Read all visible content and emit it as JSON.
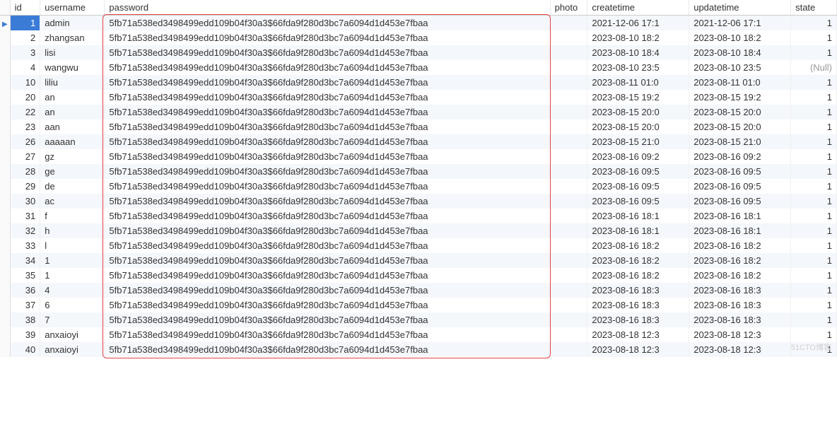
{
  "headers": {
    "id": "id",
    "username": "username",
    "password": "password",
    "photo": "photo",
    "createtime": "createtime",
    "updatetime": "updatetime",
    "state": "state"
  },
  "null_text": "(Null)",
  "watermark": "51CTO博客",
  "password_hash": "5fb71a538ed3498499edd109b04f30a3$66fda9f280d3bc7a6094d1d453e7fbaa",
  "rows": [
    {
      "id": "1",
      "username": "admin",
      "createtime": "2021-12-06 17:1",
      "updatetime": "2021-12-06 17:1",
      "state": "1",
      "state_null": false,
      "selected": true
    },
    {
      "id": "2",
      "username": "zhangsan",
      "createtime": "2023-08-10 18:2",
      "updatetime": "2023-08-10 18:2",
      "state": "1",
      "state_null": false,
      "selected": false
    },
    {
      "id": "3",
      "username": "lisi",
      "createtime": "2023-08-10 18:4",
      "updatetime": "2023-08-10 18:4",
      "state": "1",
      "state_null": false,
      "selected": false
    },
    {
      "id": "4",
      "username": "wangwu",
      "createtime": "2023-08-10 23:5",
      "updatetime": "2023-08-10 23:5",
      "state": "",
      "state_null": true,
      "selected": false
    },
    {
      "id": "10",
      "username": "liliu",
      "createtime": "2023-08-11 01:0",
      "updatetime": "2023-08-11 01:0",
      "state": "1",
      "state_null": false,
      "selected": false
    },
    {
      "id": "20",
      "username": "an",
      "createtime": "2023-08-15 19:2",
      "updatetime": "2023-08-15 19:2",
      "state": "1",
      "state_null": false,
      "selected": false
    },
    {
      "id": "22",
      "username": "an",
      "createtime": "2023-08-15 20:0",
      "updatetime": "2023-08-15 20:0",
      "state": "1",
      "state_null": false,
      "selected": false
    },
    {
      "id": "23",
      "username": "aan",
      "createtime": "2023-08-15 20:0",
      "updatetime": "2023-08-15 20:0",
      "state": "1",
      "state_null": false,
      "selected": false
    },
    {
      "id": "26",
      "username": "aaaaan",
      "createtime": "2023-08-15 21:0",
      "updatetime": "2023-08-15 21:0",
      "state": "1",
      "state_null": false,
      "selected": false
    },
    {
      "id": "27",
      "username": "gz",
      "createtime": "2023-08-16 09:2",
      "updatetime": "2023-08-16 09:2",
      "state": "1",
      "state_null": false,
      "selected": false
    },
    {
      "id": "28",
      "username": "ge",
      "createtime": "2023-08-16 09:5",
      "updatetime": "2023-08-16 09:5",
      "state": "1",
      "state_null": false,
      "selected": false
    },
    {
      "id": "29",
      "username": "de",
      "createtime": "2023-08-16 09:5",
      "updatetime": "2023-08-16 09:5",
      "state": "1",
      "state_null": false,
      "selected": false
    },
    {
      "id": "30",
      "username": "ac",
      "createtime": "2023-08-16 09:5",
      "updatetime": "2023-08-16 09:5",
      "state": "1",
      "state_null": false,
      "selected": false
    },
    {
      "id": "31",
      "username": "f",
      "createtime": "2023-08-16 18:1",
      "updatetime": "2023-08-16 18:1",
      "state": "1",
      "state_null": false,
      "selected": false
    },
    {
      "id": "32",
      "username": "h",
      "createtime": "2023-08-16 18:1",
      "updatetime": "2023-08-16 18:1",
      "state": "1",
      "state_null": false,
      "selected": false
    },
    {
      "id": "33",
      "username": "l",
      "createtime": "2023-08-16 18:2",
      "updatetime": "2023-08-16 18:2",
      "state": "1",
      "state_null": false,
      "selected": false
    },
    {
      "id": "34",
      "username": "1",
      "createtime": "2023-08-16 18:2",
      "updatetime": "2023-08-16 18:2",
      "state": "1",
      "state_null": false,
      "selected": false
    },
    {
      "id": "35",
      "username": "1",
      "createtime": "2023-08-16 18:2",
      "updatetime": "2023-08-16 18:2",
      "state": "1",
      "state_null": false,
      "selected": false
    },
    {
      "id": "36",
      "username": "4",
      "createtime": "2023-08-16 18:3",
      "updatetime": "2023-08-16 18:3",
      "state": "1",
      "state_null": false,
      "selected": false
    },
    {
      "id": "37",
      "username": "6",
      "createtime": "2023-08-16 18:3",
      "updatetime": "2023-08-16 18:3",
      "state": "1",
      "state_null": false,
      "selected": false
    },
    {
      "id": "38",
      "username": "7",
      "createtime": "2023-08-16 18:3",
      "updatetime": "2023-08-16 18:3",
      "state": "1",
      "state_null": false,
      "selected": false
    },
    {
      "id": "39",
      "username": "anxaioyi",
      "createtime": "2023-08-18 12:3",
      "updatetime": "2023-08-18 12:3",
      "state": "1",
      "state_null": false,
      "selected": false
    },
    {
      "id": "40",
      "username": "anxaioyi",
      "createtime": "2023-08-18 12:3",
      "updatetime": "2023-08-18 12:3",
      "state": "1",
      "state_null": false,
      "selected": false
    }
  ]
}
